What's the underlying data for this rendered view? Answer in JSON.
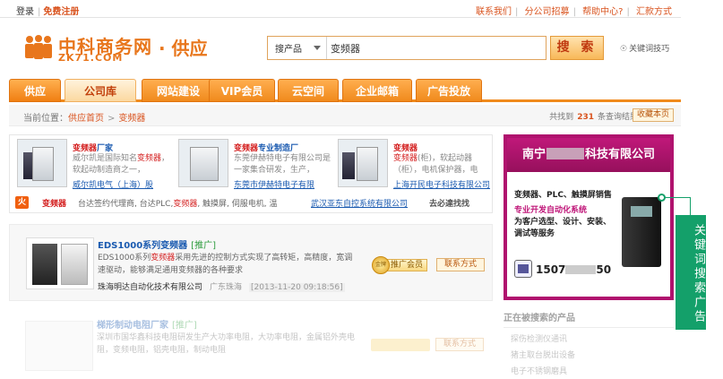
{
  "topbar": {
    "login": "登录",
    "register": "免费注册",
    "links": [
      "联系我们",
      "分公司招募",
      "帮助中心?",
      "汇款方式"
    ]
  },
  "header": {
    "logo_cn": "中科商务网",
    "logo_en": "ZK71.COM",
    "logo_sub": "· 供应",
    "search_category": "搜产品",
    "search_value": "变频器",
    "search_button": "搜 索",
    "tips": "关键词技巧"
  },
  "nav": {
    "tabs": [
      "供应",
      "公司库",
      "网站建设",
      "VIP会员",
      "云空间",
      "企业邮箱",
      "广告投放"
    ]
  },
  "breadcrumb": {
    "prefix": "当前位置：",
    "home": "供应首页",
    "current": "变频器",
    "result_prefix": "共找到",
    "result_count": "231",
    "result_suffix": "条查询结果",
    "subscribe": "收藏本页"
  },
  "featured": [
    {
      "title_hl": "变频器",
      "title": "厂家",
      "desc_a": "威尔凯是国际知名",
      "desc_hl": "变频器",
      "desc_b": "，软起动制造商之一，",
      "company": "威尔凯电气（上海）股"
    },
    {
      "title_hl": "变频器",
      "title": "专业制造厂",
      "desc_a": "东莞伊赫特电子有限公司是一家集合研发，生产，",
      "desc_hl": "",
      "desc_b": "",
      "company": "东莞市伊赫特电子有限"
    },
    {
      "title_hl": "变频器",
      "title": "",
      "desc_a": "",
      "desc_hl": "变频器",
      "desc_b": "(柜)，软起动器（柜），电机保护器，电",
      "company": "上海开民电子科技有限公司"
    }
  ],
  "hotline": {
    "badge": "火",
    "keyword": "变频器",
    "text_a": "台达签约代理商, 台达PLC,",
    "text_hl": "变频器",
    "text_b": ", 触摸屏, 伺服电机, 温",
    "company": "武汉亚东自控系统有限公司",
    "go": "去必達找找"
  },
  "listing": {
    "title": "EDS1000系列变频器",
    "promo": "[推广]",
    "desc_a": "EDS1000系列",
    "desc_hl": "变频器",
    "desc_b": "采用先进的控制方式实现了高转矩，高精度，宽调速驱动，能够满足通用变频器的各种要求",
    "company": "珠海明达自动化技术有限公司",
    "location": "广东珠海",
    "time": "[2013-11-20 09:18:56]",
    "coin": "金牌",
    "member": "推广会员",
    "contact": "联系方式"
  },
  "listing2": {
    "title": "梯形制动电阻厂家",
    "promo": "[推广]",
    "desc": "深圳市国华鑫科技电阻研发生产大功率电阻，大功率电阻，金属铝外壳电阻，变频电阻，铝壳电阻，制动电阻",
    "contact": "联系方式"
  },
  "ad": {
    "head_a": "南宁",
    "head_b": "科技有限公司",
    "line1": "变频器、PLC、触摸屏销售",
    "line2": "专业开发自动化系统",
    "line3": "为客户选型、设计、安装、调试等服务",
    "phone_a": "1507",
    "phone_b": "50"
  },
  "callout": {
    "text": "关键词搜索广告"
  },
  "hotsearch": {
    "title": "正在被搜索的产品",
    "items": [
      "探伤检测仪通讯",
      "猪主取台脱出设备",
      "电子不锈钢磨具"
    ]
  }
}
